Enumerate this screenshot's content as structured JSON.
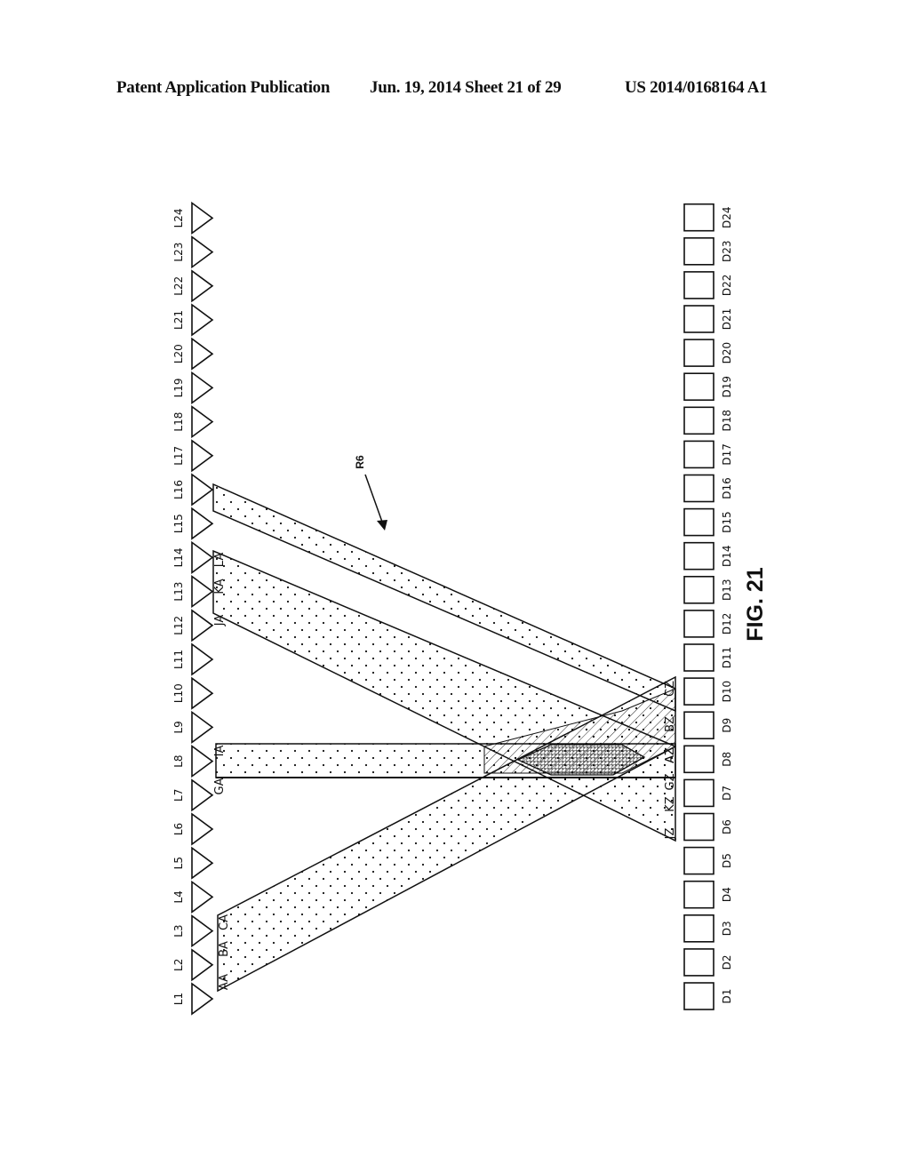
{
  "header": {
    "publication": "Patent Application Publication",
    "date_sheet": "Jun. 19, 2014  Sheet 21 of 29",
    "number": "US 2014/0168164 A1"
  },
  "figure": {
    "label": "FIG. 21",
    "callout": "R6",
    "emitters": [
      "L1",
      "L2",
      "L3",
      "L4",
      "L5",
      "L6",
      "L7",
      "L8",
      "L9",
      "L10",
      "L11",
      "L12",
      "L13",
      "L14",
      "L15",
      "L16",
      "L17",
      "L18",
      "L19",
      "L20",
      "L21",
      "L22",
      "L23",
      "L24"
    ],
    "detectors": [
      "D1",
      "D2",
      "D3",
      "D4",
      "D5",
      "D6",
      "D7",
      "D8",
      "D9",
      "D10",
      "D11",
      "D12",
      "D13",
      "D14",
      "D15",
      "D16",
      "D17",
      "D18",
      "D19",
      "D20",
      "D21",
      "D22",
      "D23",
      "D24"
    ],
    "beams": [
      {
        "name": "beam-a-to-d9-d10",
        "from_emitters": [
          "L1",
          "L3"
        ],
        "to_detectors": [
          "D8",
          "D10"
        ],
        "start_labels": [
          "AA",
          "BA",
          "CA"
        ],
        "end_labels": [
          "AZ",
          "BZ",
          "CZ"
        ]
      },
      {
        "name": "beam-l8",
        "from_emitters": [
          "L7",
          "L8"
        ],
        "to_detectors": [
          "D7",
          "D8"
        ],
        "start_labels": [
          "GA",
          "IA"
        ],
        "end_labels": [
          "GZ",
          "AZ"
        ]
      },
      {
        "name": "beam-j-to-d6",
        "from_emitters": [
          "L12",
          "L14"
        ],
        "to_detectors": [
          "D6",
          "D8"
        ],
        "start_labels": [
          "JA",
          "KA",
          "LA"
        ],
        "end_labels": [
          "JZ",
          "KZ"
        ]
      },
      {
        "name": "beam-l16-to-d9",
        "from_emitters": [
          "L16"
        ],
        "to_detectors": [
          "D9",
          "D10"
        ],
        "start_labels": [],
        "end_labels": []
      }
    ]
  }
}
